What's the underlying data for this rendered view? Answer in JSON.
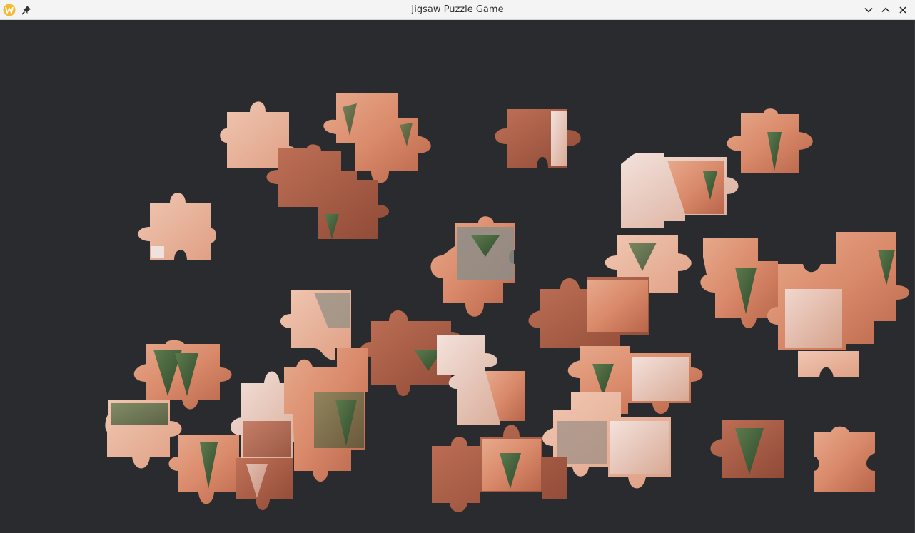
{
  "window": {
    "title": "Jigsaw Puzzle Game"
  },
  "icons": {
    "app": "app-logo-icon",
    "pin": "pin-icon",
    "minimize": "chevron-down-icon",
    "maximize": "chevron-up-icon",
    "close": "close-icon"
  },
  "colors": {
    "canvas_bg": "#2a2b2e",
    "titlebar_bg": "#f4f4f4",
    "app_icon": "#f5b82e",
    "rock_orange": "#d9886a",
    "rock_light": "#e8b39c",
    "rock_white": "#ead6cf",
    "tree_green": "#3f5e3a"
  }
}
